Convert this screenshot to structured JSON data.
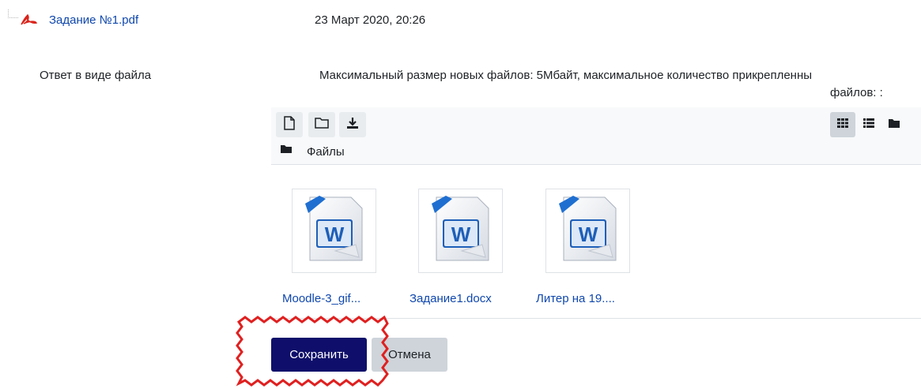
{
  "attachment": {
    "name": "Задание №1.pdf",
    "date": "23 Март 2020, 20:26",
    "icon": "pdf-icon"
  },
  "submission": {
    "label": "Ответ в виде файла",
    "limits_line1": "Максимальный размер новых файлов: 5Мбайт, максимальное количество прикрепленны",
    "limits_line2": "файлов: :"
  },
  "filemanager": {
    "toolbar_icons": [
      "add-file-icon",
      "create-folder-icon",
      "download-icon"
    ],
    "view_icons": [
      "icons-view-icon",
      "list-view-icon",
      "tree-view-icon"
    ],
    "path": "Файлы",
    "files": [
      {
        "name": "Moodle-3_gif...",
        "icon": "word-document-icon"
      },
      {
        "name": "Задание1.docx",
        "icon": "word-document-icon"
      },
      {
        "name": "Литер на 19....",
        "icon": "word-document-icon"
      }
    ]
  },
  "buttons": {
    "save": "Сохранить",
    "cancel": "Отмена"
  },
  "colors": {
    "link": "#0f47ad",
    "primary": "#0f0f6b",
    "secondary": "#ced4da",
    "highlight": "#e02020"
  }
}
